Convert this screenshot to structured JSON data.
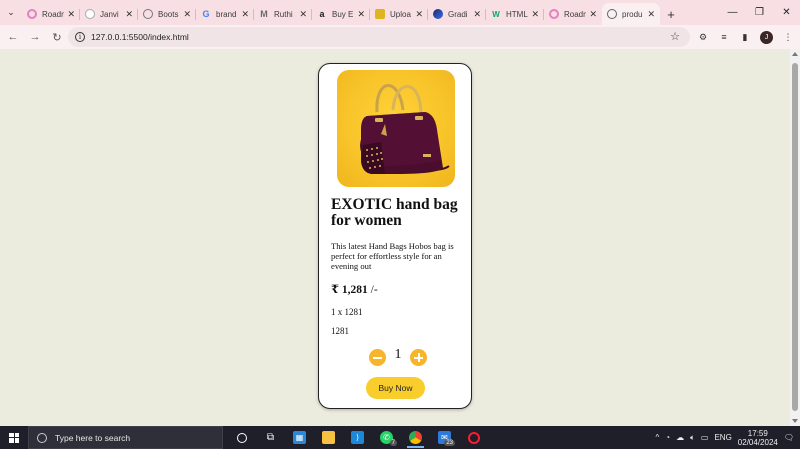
{
  "browser": {
    "tabs": [
      {
        "title": "Roadm",
        "icon": "roadmap-icon",
        "color": "#e57fbf"
      },
      {
        "title": "Janvi",
        "icon": "globe-icon",
        "color": "#ffffff"
      },
      {
        "title": "Boots",
        "icon": "globe-icon",
        "color": "#9aa0a6"
      },
      {
        "title": "brand",
        "icon": "google-icon",
        "color": "#4285f4"
      },
      {
        "title": "Ruthi",
        "icon": "medium-icon",
        "color": "#6b6b6b"
      },
      {
        "title": "Buy E",
        "icon": "amazon-icon",
        "color": "#222222"
      },
      {
        "title": "Uploa",
        "icon": "upload-icon",
        "color": "#e0b41e"
      },
      {
        "title": "Gradi",
        "icon": "gradient-icon",
        "color": "#3a6ee8"
      },
      {
        "title": "HTML",
        "icon": "w3schools-icon",
        "color": "#04aa6d"
      },
      {
        "title": "Roadm",
        "icon": "roadmap-icon",
        "color": "#e57fbf"
      },
      {
        "title": "produ",
        "icon": "globe-icon",
        "color": "#5f6368",
        "active": true
      }
    ],
    "url": "127.0.0.1:5500/index.html"
  },
  "product": {
    "title": "EXOTIC hand bag for women",
    "description": "This latest Hand Bags Hobos bag is perfect for effortless style for an evening out",
    "price_symbol": "₹",
    "price": "1,281",
    "price_suffix": "/-",
    "calc": "1 x 1281",
    "total": "1281",
    "quantity": "1",
    "buy_label": "Buy Now",
    "image_bg": "#f8c52a",
    "bag_color": "#4a0d2e"
  },
  "taskbar": {
    "search_placeholder": "Type here to search",
    "apps": [
      {
        "name": "task-view",
        "icon": "task-view-icon",
        "badge": ""
      },
      {
        "name": "widgets",
        "icon": "widgets-icon",
        "badge": ""
      },
      {
        "name": "store",
        "icon": "store-icon",
        "badge": ""
      },
      {
        "name": "file-explorer",
        "icon": "folder-icon",
        "badge": ""
      },
      {
        "name": "vscode",
        "icon": "vscode-icon",
        "badge": ""
      },
      {
        "name": "whatsapp",
        "icon": "whatsapp-icon",
        "badge": "7"
      },
      {
        "name": "chrome",
        "icon": "chrome-icon",
        "badge": ""
      },
      {
        "name": "mail",
        "icon": "mail-icon",
        "badge": "23"
      },
      {
        "name": "opera",
        "icon": "opera-icon",
        "badge": ""
      }
    ],
    "language": "ENG",
    "time": "17:59",
    "date": "02/04/2024"
  }
}
